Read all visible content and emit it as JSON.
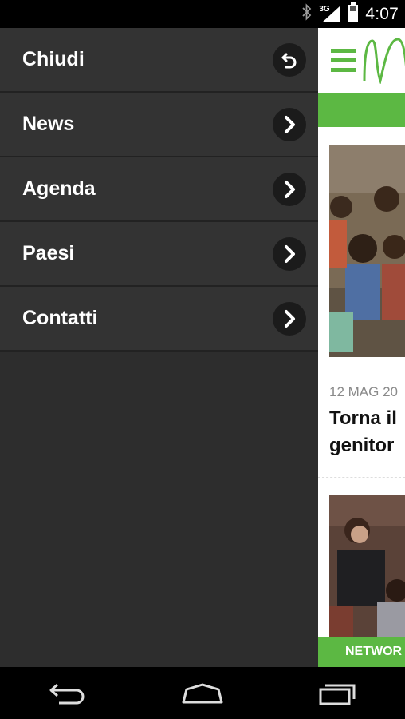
{
  "status_bar": {
    "time": "4:07",
    "network": "3G",
    "icons": [
      "bluetooth-icon",
      "signal-icon",
      "battery-icon"
    ]
  },
  "drawer": {
    "items": [
      {
        "label": "Chiudi",
        "icon": "back-arrow-icon"
      },
      {
        "label": "News",
        "icon": "chevron-right-icon"
      },
      {
        "label": "Agenda",
        "icon": "chevron-right-icon"
      },
      {
        "label": "Paesi",
        "icon": "chevron-right-icon"
      },
      {
        "label": "Contatti",
        "icon": "chevron-right-icon"
      }
    ]
  },
  "content": {
    "article": {
      "date": "12 MAG 20",
      "headline_line1": "Torna il",
      "headline_line2": "genitor"
    },
    "footer_tab": "NETWOR"
  },
  "colors": {
    "accent_green": "#5cb843",
    "drawer_bg": "#333333"
  },
  "navigation": [
    "back-icon",
    "home-icon",
    "recents-icon"
  ]
}
